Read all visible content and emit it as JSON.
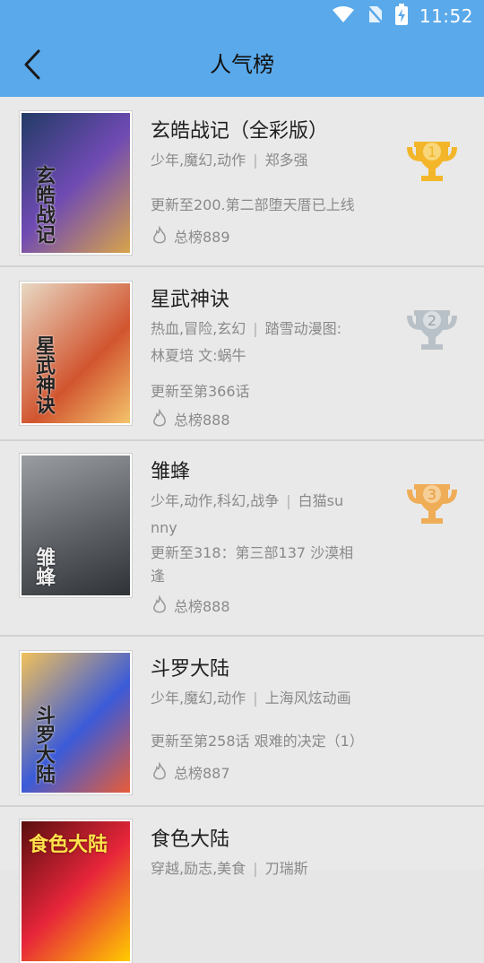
{
  "status": {
    "time": "11:52"
  },
  "header": {
    "title": "人气榜"
  },
  "items": [
    {
      "name": "玄皓战记（全彩版）",
      "tags": "少年,魔幻,动作",
      "author": "郑多强",
      "update": "更新至200.第二部堕天厝已上线",
      "rank_label": "总榜889",
      "trophy": {
        "rank": "1",
        "color": "#f3b62a"
      }
    },
    {
      "name": "星武神诀",
      "tags": "热血,冒险,玄幻",
      "author": "踏雪动漫图:",
      "author_line2": "林夏培 文:蜗牛",
      "update": "更新至第366话",
      "rank_label": "总榜888",
      "trophy": {
        "rank": "2",
        "color": "#b9c1c8"
      }
    },
    {
      "name": "雏蜂",
      "tags": "少年,动作,科幻,战争",
      "author": "白猫su",
      "author_line2": "nny",
      "update": "更新至318：第三部137 沙漠相",
      "update_line2": "逢",
      "rank_label": "总榜888",
      "trophy": {
        "rank": "3",
        "color": "#f0ad57"
      }
    },
    {
      "name": "斗罗大陆",
      "tags": "少年,魔幻,动作",
      "author": "上海风炫动画",
      "update": "更新至第258话 艰难的决定（1）",
      "rank_label": "总榜887"
    },
    {
      "name": "食色大陆",
      "tags": "穿越,励志,美食",
      "author": "刀瑞斯"
    }
  ],
  "covers": [
    {
      "text": "玄皓战记",
      "colors": [
        "#223b66",
        "#6f4ab3",
        "#d8a44a"
      ]
    },
    {
      "text": "星武神诀",
      "colors": [
        "#e8d9c4",
        "#d1552f",
        "#f4c46c"
      ]
    },
    {
      "text": "雏蜂",
      "colors": [
        "#5d6166",
        "#9a9da2",
        "#2f3338"
      ]
    },
    {
      "text": "斗罗大陆",
      "colors": [
        "#f1c15a",
        "#3b5bd8",
        "#e85c38"
      ]
    },
    {
      "text": "食色大陆",
      "colors": [
        "#5a0f0f",
        "#ffcc00",
        "#e6253a"
      ]
    }
  ]
}
